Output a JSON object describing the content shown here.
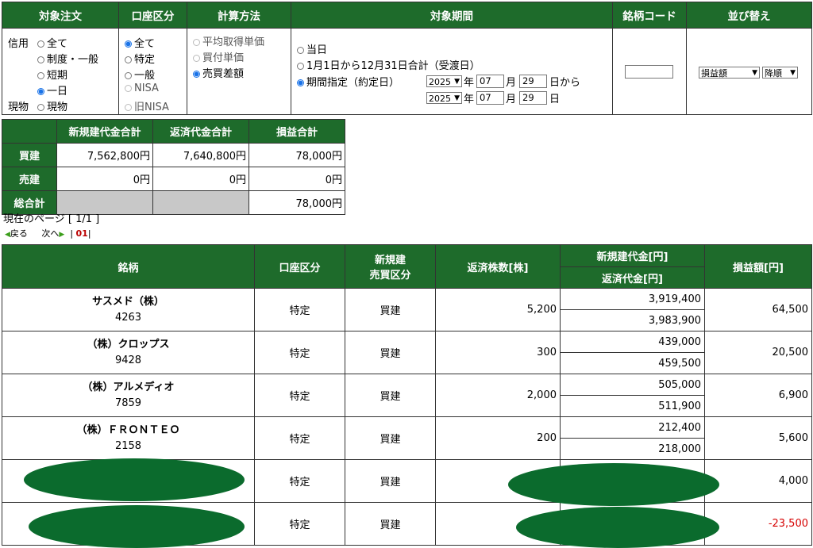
{
  "filter": {
    "headers": [
      "対象注文",
      "口座区分",
      "計算方法",
      "対象期間",
      "銘柄コード",
      "並び替え"
    ],
    "order": {
      "credit_label": "信用",
      "spot_label": "現物",
      "options": [
        "全て",
        "制度・一般",
        "短期",
        "一日"
      ],
      "spot_option": "現物"
    },
    "account": {
      "options": [
        "全て",
        "特定",
        "一般",
        "NISA",
        "旧NISA"
      ]
    },
    "calc": {
      "options": [
        "平均取得単価",
        "買付単価",
        "売買差額"
      ]
    },
    "period": {
      "today": "当日",
      "year_total": "1月1日から12月31日合計（受渡日）",
      "range": "期間指定（約定日）",
      "from": {
        "year": "2025",
        "month": "07",
        "day": "29"
      },
      "to": {
        "year": "2025",
        "month": "07",
        "day": "29"
      },
      "year_unit": "年",
      "month_unit": "月",
      "day_unit": "日",
      "from_suffix": "日から"
    },
    "code": {
      "value": ""
    },
    "sort": {
      "field": "損益額",
      "direction": "降順"
    }
  },
  "summary": {
    "headers": [
      "新規建代金合計",
      "返済代金合計",
      "損益合計"
    ],
    "rows": [
      {
        "label": "買建",
        "open": "7,562,800円",
        "close": "7,640,800円",
        "pl": "78,000円"
      },
      {
        "label": "売建",
        "open": "0円",
        "close": "0円",
        "pl": "0円"
      }
    ],
    "total": {
      "label": "総合計",
      "pl": "78,000円"
    }
  },
  "page": {
    "current": "現在のページ [ 1/1 ]",
    "back": "戻る",
    "next": "次へ",
    "num": "01"
  },
  "detail": {
    "headers": {
      "name": "銘柄",
      "account": "口座区分",
      "side_top": "新規建",
      "side_bottom": "売買区分",
      "qty": "返済株数[株]",
      "open": "新規建代金[円]",
      "close": "返済代金[円]",
      "pl": "損益額[円]"
    },
    "rows": [
      {
        "name": "サスメド（株）",
        "code": "4263",
        "account": "特定",
        "side": "買建",
        "qty": "5,200",
        "open": "3,919,400",
        "close": "3,983,900",
        "pl": "64,500"
      },
      {
        "name": "（株）クロップス",
        "code": "9428",
        "account": "特定",
        "side": "買建",
        "qty": "300",
        "open": "439,000",
        "close": "459,500",
        "pl": "20,500"
      },
      {
        "name": "（株）アルメディオ",
        "code": "7859",
        "account": "特定",
        "side": "買建",
        "qty": "2,000",
        "open": "505,000",
        "close": "511,900",
        "pl": "6,900"
      },
      {
        "name": "（株）ＦＲＯＮＴＥＯ",
        "code": "2158",
        "account": "特定",
        "side": "買建",
        "qty": "200",
        "open": "212,400",
        "close": "218,000",
        "pl": "5,600"
      },
      {
        "name": "",
        "code": "",
        "account": "特定",
        "side": "買建",
        "qty": "",
        "open": "",
        "close": "",
        "pl": "4,000"
      },
      {
        "name": "",
        "code": "",
        "account": "特定",
        "side": "買建",
        "qty": "",
        "open": "",
        "close": "",
        "pl": "-23,500"
      }
    ]
  },
  "colors": {
    "header_green": "#1e6b2b",
    "negative": "#d60000",
    "redaction": "#0b6b2d"
  }
}
